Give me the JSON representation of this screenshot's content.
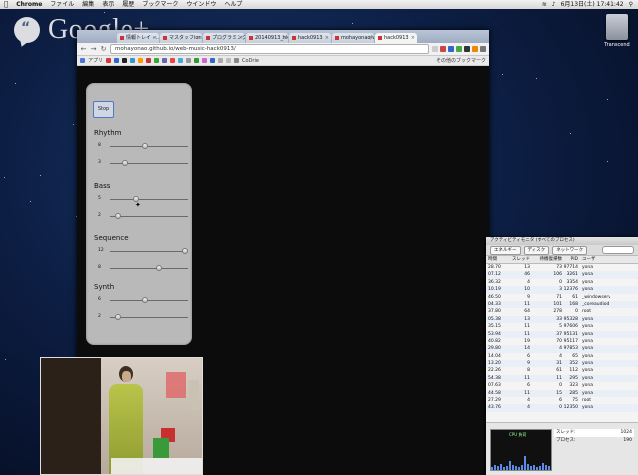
{
  "menubar": {
    "app": "Chrome",
    "items": [
      "ファイル",
      "編集",
      "表示",
      "履歴",
      "ブックマーク",
      "ウインドウ",
      "ヘルプ"
    ],
    "clock": "6月13日(土) 17:41:42"
  },
  "overlay": {
    "logo_text": "Google+"
  },
  "desktop": {
    "drive_label": "Transcend"
  },
  "browser": {
    "tabs": [
      {
        "label": "情報トレイ - ..."
      },
      {
        "label": "マスタッフion..."
      },
      {
        "label": "プログラミング..."
      },
      {
        "label": "20140913_hk..."
      },
      {
        "label": "hack0913"
      },
      {
        "label": "mohayonao/w..."
      },
      {
        "label": "hack0913"
      }
    ],
    "active_tab_index": 6,
    "url": "mohayonao.github.io/web-music-hack0913/",
    "bookmarks_apps_label": "アプリ",
    "bookmarks_codeit_label": "CoDrie",
    "bookmarks_other_label": "その他のブックマーク"
  },
  "panel": {
    "stop_label": "Stop",
    "sections": [
      {
        "title": "Rhythm",
        "rows": [
          {
            "label": "8",
            "value": 0.47
          },
          {
            "label": "3",
            "value": 0.2
          }
        ]
      },
      {
        "title": "Bass",
        "rows": [
          {
            "label": "5",
            "value": 0.35
          },
          {
            "label": "2",
            "value": 0.1
          }
        ]
      },
      {
        "title": "Sequence",
        "rows": [
          {
            "label": "12",
            "value": 1.0
          },
          {
            "label": "8",
            "value": 0.65
          }
        ]
      },
      {
        "title": "Synth",
        "rows": [
          {
            "label": "6",
            "value": 0.47
          },
          {
            "label": "2",
            "value": 0.1
          }
        ]
      }
    ]
  },
  "activity_monitor": {
    "title": "アクティビティモニタ (すべてのプロセス)",
    "tabs": [
      "エネルギー",
      "ディスク",
      "ネットワーク"
    ],
    "columns": [
      "時間",
      "スレッド",
      "待機復帰数",
      "PID",
      "ユーザ"
    ],
    "rows": [
      [
        "28.70",
        "13",
        "73",
        "97714",
        "yona"
      ],
      [
        "07.12",
        "46",
        "106",
        "3261",
        "yona"
      ],
      [
        "36.32",
        "4",
        "0",
        "3354",
        "yona"
      ],
      [
        "10.19",
        "10",
        "3",
        "12376",
        "yona"
      ],
      [
        "46.50",
        "9",
        "71",
        "61",
        "_windowserv"
      ],
      [
        "04.33",
        "11",
        "101",
        "168",
        "_coreaudiod"
      ],
      [
        "37.80",
        "64",
        "278",
        "0",
        "root"
      ],
      [
        "05.38",
        "13",
        "33",
        "95328",
        "yona"
      ],
      [
        "35.15",
        "11",
        "5",
        "97606",
        "yona"
      ],
      [
        "53.94",
        "11",
        "37",
        "95131",
        "yona"
      ],
      [
        "40.82",
        "19",
        "70",
        "95117",
        "yona"
      ],
      [
        "29.80",
        "14",
        "4",
        "97853",
        "yona"
      ],
      [
        "14.04",
        "6",
        "4",
        "65",
        "yona"
      ],
      [
        "13.20",
        "9",
        "31",
        "352",
        "yona"
      ],
      [
        "22.26",
        "8",
        "61",
        "112",
        "yona"
      ],
      [
        "54.38",
        "11",
        "11",
        "295",
        "yona"
      ],
      [
        "07.63",
        "6",
        "0",
        "323",
        "yona"
      ],
      [
        "44.58",
        "11",
        "15",
        "285",
        "yona"
      ],
      [
        "27.29",
        "4",
        "6",
        "75",
        "root"
      ],
      [
        "43.76",
        "4",
        "0",
        "12350",
        "yona"
      ]
    ],
    "cpu_label": "CPU 負荷",
    "stats": [
      {
        "label": "スレッド:",
        "value": "1024"
      },
      {
        "label": "プロセス:",
        "value": "190"
      }
    ]
  }
}
